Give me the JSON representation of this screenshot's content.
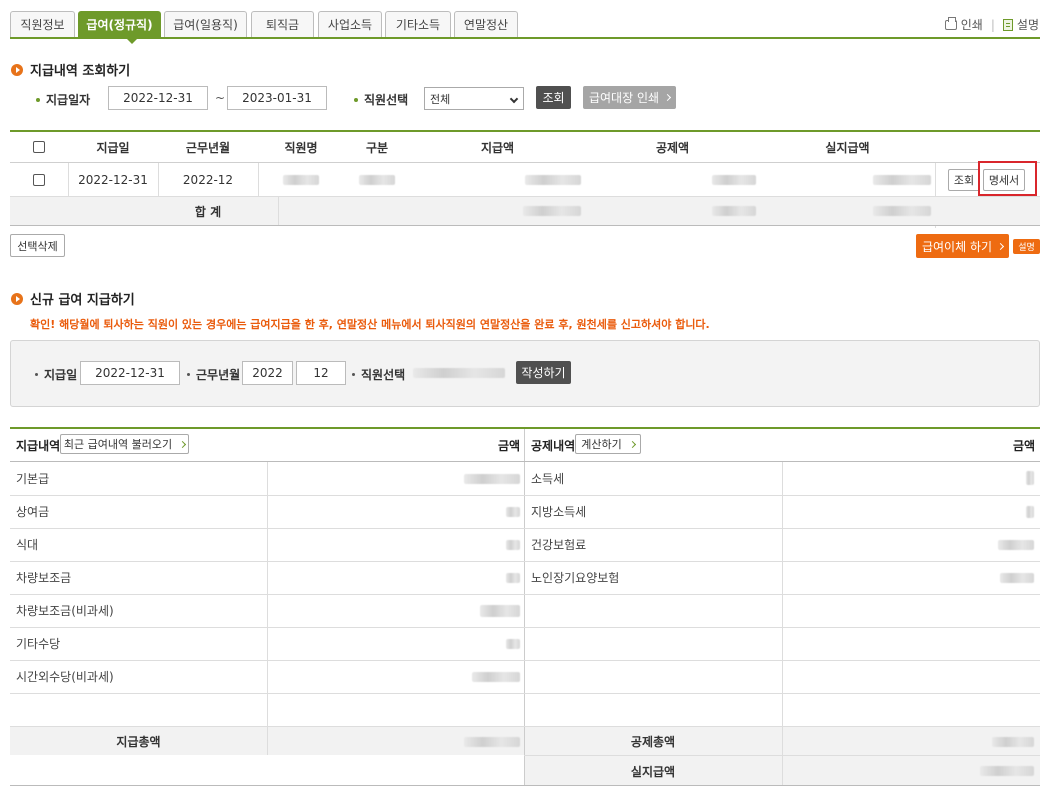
{
  "tabs": [
    {
      "label": "직원정보",
      "active": false
    },
    {
      "label": "급여(정규직)",
      "active": true
    },
    {
      "label": "급여(일용직)",
      "active": false
    },
    {
      "label": "퇴직금",
      "active": false
    },
    {
      "label": "사업소득",
      "active": false
    },
    {
      "label": "기타소득",
      "active": false
    },
    {
      "label": "연말정산",
      "active": false
    }
  ],
  "top_links": {
    "print": "인쇄",
    "help": "설명"
  },
  "search": {
    "title": "지급내역 조회하기",
    "date_label": "지급일자",
    "date_from": "2022-12-31",
    "tilde": "~",
    "date_to": "2023-01-31",
    "employee_label": "직원선택",
    "employee_value": "전체",
    "search_button": "조회",
    "print_ledger_button": "급여대장 인쇄"
  },
  "list": {
    "headers": [
      "지급일",
      "근무년월",
      "직원명",
      "구분",
      "지급액",
      "공제액",
      "실지급액"
    ],
    "rows": [
      {
        "pay_date": "2022-12-31",
        "work_month": "2022-12",
        "view_button": "조회",
        "statement_button": "명세서"
      }
    ],
    "total_label": "합 계"
  },
  "actions": {
    "delete_selected": "선택삭제",
    "transfer": "급여이체 하기",
    "transfer_help": "설명"
  },
  "new_pay": {
    "title": "신규 급여 지급하기",
    "notice": "확인! 해당월에 퇴사하는 직원이 있는 경우에는 급여지급을 한 후, 연말정산 메뉴에서 퇴사직원의 연말정산을 완료 후, 원천세를 신고하셔야 합니다.",
    "pay_date_label": "지급일",
    "pay_date": "2022-12-31",
    "work_month_label": "근무년월",
    "work_year": "2022",
    "work_month": "12",
    "employee_label": "직원선택",
    "create_button": "작성하기"
  },
  "detail": {
    "pay_header": "지급내역",
    "load_recent": "최근 급여내역 불러오기",
    "amount_header": "금액",
    "deduct_header": "공제내역",
    "calc_button": "계산하기",
    "pay_items": [
      "기본급",
      "상여금",
      "식대",
      "차량보조금",
      "차량보조금(비과세)",
      "기타수당",
      "시간외수당(비과세)"
    ],
    "deduct_items": [
      "소득세",
      "지방소득세",
      "건강보험료",
      "노인장기요양보험"
    ],
    "pay_total_label": "지급총액",
    "deduct_total_label": "공제총액",
    "net_label": "실지급액"
  }
}
